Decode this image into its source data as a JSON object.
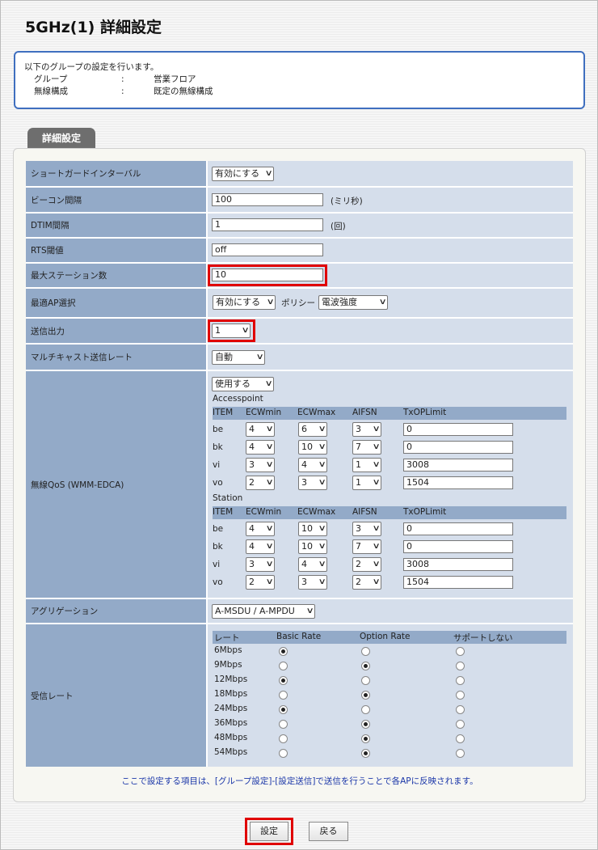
{
  "title": "5GHz(1) 詳細設定",
  "info": {
    "intro": "以下のグループの設定を行います。",
    "rows": [
      {
        "key": "グループ",
        "sep": ":",
        "value": "営業フロア"
      },
      {
        "key": "無線構成",
        "sep": ":",
        "value": "既定の無線構成"
      }
    ]
  },
  "tab_label": "詳細設定",
  "settings": {
    "guard_interval": {
      "label": "ショートガードインターバル",
      "value": "有効にする"
    },
    "beacon": {
      "label": "ビーコン間隔",
      "value": "100",
      "unit": "(ミリ秒)"
    },
    "dtim": {
      "label": "DTIM間隔",
      "value": "1",
      "unit": "(回)"
    },
    "rts": {
      "label": "RTS閾値",
      "value": "off"
    },
    "max_station": {
      "label": "最大ステーション数",
      "value": "10"
    },
    "best_ap": {
      "label": "最適AP選択",
      "value": "有効にする",
      "policy_label": "ポリシー",
      "policy_value": "電波強度"
    },
    "tx_power": {
      "label": "送信出力",
      "value": "1"
    },
    "multicast": {
      "label": "マルチキャスト送信レート",
      "value": "自動"
    },
    "qos": {
      "label": "無線QoS (WMM-EDCA)",
      "value": "使用する",
      "columns": [
        "ITEM",
        "ECWmin",
        "ECWmax",
        "AIFSN",
        "TxOPLimit"
      ],
      "accesspoint": {
        "title": "Accesspoint",
        "rows": [
          {
            "item": "be",
            "ecwmin": "4",
            "ecwmax": "6",
            "aifsn": "3",
            "txop": "0"
          },
          {
            "item": "bk",
            "ecwmin": "4",
            "ecwmax": "10",
            "aifsn": "7",
            "txop": "0"
          },
          {
            "item": "vi",
            "ecwmin": "3",
            "ecwmax": "4",
            "aifsn": "1",
            "txop": "3008"
          },
          {
            "item": "vo",
            "ecwmin": "2",
            "ecwmax": "3",
            "aifsn": "1",
            "txop": "1504"
          }
        ]
      },
      "station": {
        "title": "Station",
        "rows": [
          {
            "item": "be",
            "ecwmin": "4",
            "ecwmax": "10",
            "aifsn": "3",
            "txop": "0"
          },
          {
            "item": "bk",
            "ecwmin": "4",
            "ecwmax": "10",
            "aifsn": "7",
            "txop": "0"
          },
          {
            "item": "vi",
            "ecwmin": "3",
            "ecwmax": "4",
            "aifsn": "2",
            "txop": "3008"
          },
          {
            "item": "vo",
            "ecwmin": "2",
            "ecwmax": "3",
            "aifsn": "2",
            "txop": "1504"
          }
        ]
      }
    },
    "aggregation": {
      "label": "アグリゲーション",
      "value": "A-MSDU / A-MPDU"
    },
    "rx_rate": {
      "label": "受信レート",
      "columns": [
        "レート",
        "Basic Rate",
        "Option Rate",
        "サポートしない"
      ],
      "rows": [
        {
          "rate": "6Mbps",
          "selected": "basic"
        },
        {
          "rate": "9Mbps",
          "selected": "option"
        },
        {
          "rate": "12Mbps",
          "selected": "basic"
        },
        {
          "rate": "18Mbps",
          "selected": "option"
        },
        {
          "rate": "24Mbps",
          "selected": "basic"
        },
        {
          "rate": "36Mbps",
          "selected": "option"
        },
        {
          "rate": "48Mbps",
          "selected": "option"
        },
        {
          "rate": "54Mbps",
          "selected": "option"
        }
      ]
    }
  },
  "note": "ここで設定する項目は、[グループ設定]-[設定送信]で送信を行うことで各APに反映されます。",
  "buttons": {
    "submit": "設定",
    "back": "戻る"
  },
  "highlight_color": "#e00000"
}
